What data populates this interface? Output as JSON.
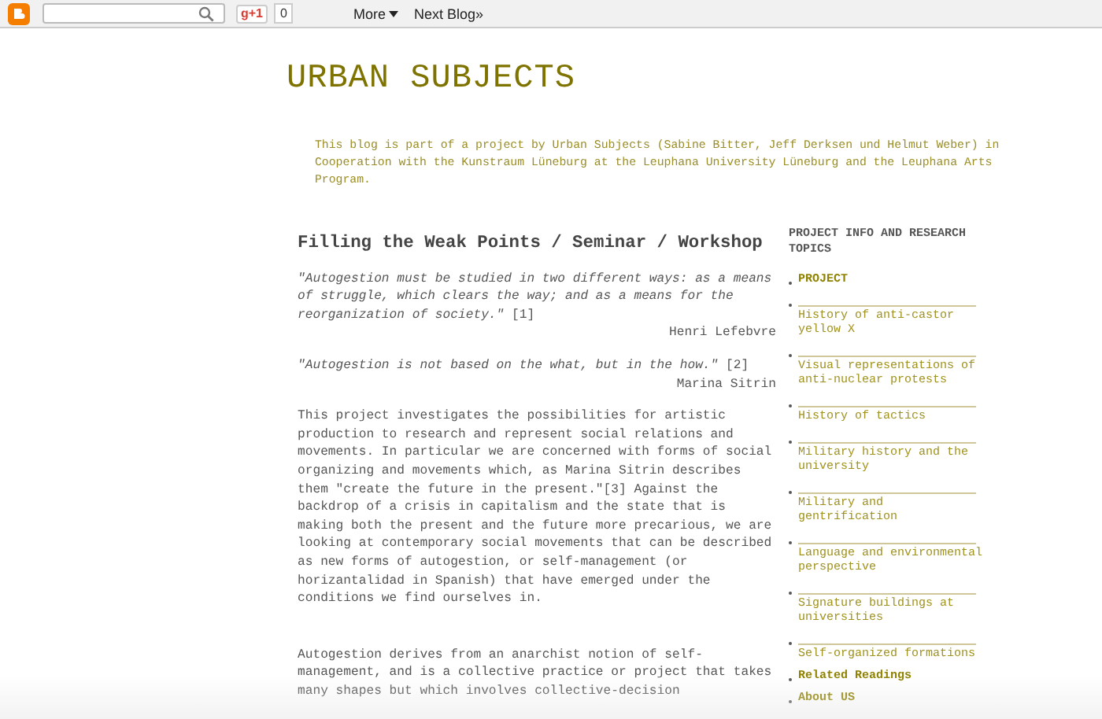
{
  "navbar": {
    "plus_one": "g+1",
    "count": "0",
    "more": "More",
    "next_blog": "Next Blog»"
  },
  "blog_title": "URBAN SUBJECTS",
  "description": "This blog is part of a project by Urban Subjects (Sabine Bitter, Jeff Derksen und Helmut Weber) in Cooperation with the Kunstraum Lüneburg at the Leuphana University Lüneburg and the Leuphana Arts Program.",
  "post": {
    "title": "Filling the Weak Points / Seminar / Workshop",
    "blocks": [
      {
        "kind": "quote",
        "text": "*\"Autogestion must be studied in two different ways: as a means of struggle, which clears the way; and as a means for the reorganization of society.\"* [1]"
      },
      {
        "kind": "attribution",
        "text": "Henri Lefebvre"
      },
      {
        "kind": "quote_tight",
        "text": "*\"Autogestion is not based on the what, but in the how.\"* [2]"
      },
      {
        "kind": "attribution",
        "text": "Marina Sitrin"
      },
      {
        "kind": "paragraph",
        "text": "This project investigates the possibilities for artistic production to research and represent social relations and movements. In particular we are concerned with forms of social organizing and movements which, as Marina Sitrin describes them \"create the future in the present.\"[3] Against the backdrop of a crisis in capitalism and the state that is making both the present and the future more precarious, we are looking at contemporary social movements that can be described as new forms of autogestion, or self-management (or horizantalidad in Spanish) that have emerged under the conditions we find ourselves in."
      },
      {
        "kind": "paragraph_gap",
        "text": "Autogestion derives from an anarchist notion of self-management, and is a collective practice or project that takes many shapes but which involves collective-decision"
      }
    ]
  },
  "sidebar": {
    "heading": "PROJECT INFO AND RESEARCH TOPICS",
    "items": [
      {
        "kind": "link",
        "label": "PROJECT"
      },
      {
        "kind": "topic",
        "label": "History of anti-castor yellow X"
      },
      {
        "kind": "topic",
        "label": "Visual representations of anti-nuclear protests"
      },
      {
        "kind": "topic",
        "label": "History of tactics"
      },
      {
        "kind": "topic",
        "label": "Military history and the university"
      },
      {
        "kind": "topic",
        "label": "Military and gentrification"
      },
      {
        "kind": "topic",
        "label": "Language and environmental perspective"
      },
      {
        "kind": "topic",
        "label": "Signature buildings at universities"
      },
      {
        "kind": "topic",
        "label": "Self-organized formations"
      },
      {
        "kind": "link",
        "label": "Related Readings"
      },
      {
        "kind": "link",
        "label": "About US"
      }
    ]
  }
}
